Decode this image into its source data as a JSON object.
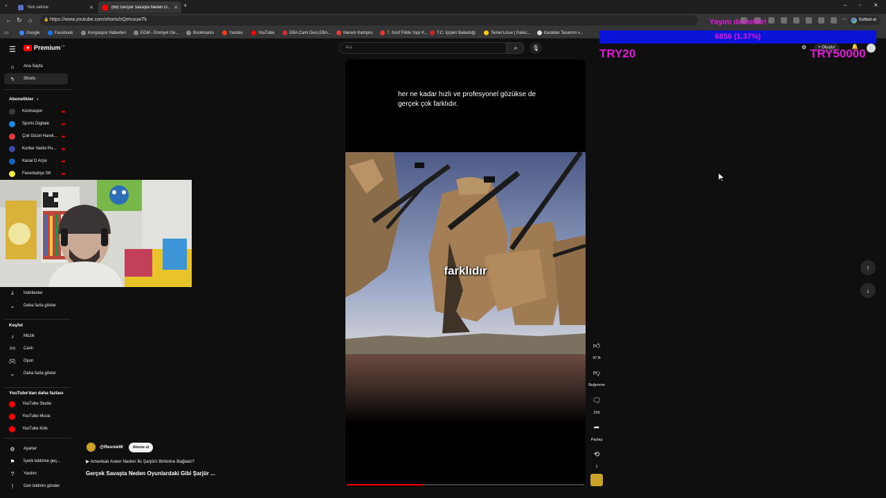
{
  "browser": {
    "tabs": [
      {
        "label": "Yeni sekme"
      },
      {
        "label": "(68) Gerçek Savaşta Neden O..."
      }
    ],
    "url": "https://www.youtube.com/shorts/nQetvuuwTk",
    "profile_label": "Sohbet et",
    "bookmarks": [
      {
        "label": "Google",
        "color": "#4285f4"
      },
      {
        "label": "Facebook",
        "color": "#1877f2"
      },
      {
        "label": "Konyaspor Haberleri",
        "color": "#888888"
      },
      {
        "label": "EGM - Emniyet Ge...",
        "color": "#888888"
      },
      {
        "label": "Bookmarks",
        "color": "#888888"
      },
      {
        "label": "Yandex",
        "color": "#fc3f1d"
      },
      {
        "label": "YouTube",
        "color": "#ff0000"
      },
      {
        "label": "EBA Canlı Ders,EBA...",
        "color": "#d32f2f"
      },
      {
        "label": "Meram Kampüs",
        "color": "#e53935"
      },
      {
        "label": "7. Sınıf Fiilde Yapı K...",
        "color": "#e53935"
      },
      {
        "label": "T.C. İçişleri Bakanlığı",
        "color": "#c62828"
      },
      {
        "label": "Temel Linux | Gelec...",
        "color": "#f9c80e"
      },
      {
        "label": "Karakter Tasarımı v...",
        "color": "#dddddd"
      }
    ]
  },
  "header": {
    "logo_text": "Premium",
    "logo_region": "TR",
    "search_placeholder": "Ara",
    "create_label": "+ Oluştur"
  },
  "sidebar": {
    "main": [
      {
        "label": "Ana Sayfa",
        "icon": "home-icon"
      },
      {
        "label": "Shorts",
        "icon": "shorts-icon"
      }
    ],
    "subscriptions_heading": "Abonelikler",
    "subscriptions": [
      {
        "label": "Kontraspor",
        "color": "#3a3a3a"
      },
      {
        "label": "Sports Digitale",
        "color": "#1e88e5"
      },
      {
        "label": "Çok Güzel Harek...",
        "color": "#e53935"
      },
      {
        "label": "Kurtlar Vadisi Pu...",
        "color": "#3949ab"
      },
      {
        "label": "Kanal D Arşiv",
        "color": "#1565c0"
      },
      {
        "label": "Fenerbahçe SK",
        "color": "#ffeb3b"
      }
    ],
    "you_items": [
      {
        "label": "İndirilenler",
        "icon": "download-icon"
      },
      {
        "label": "Daha fazla göster",
        "icon": "chevron-down-icon"
      }
    ],
    "explore_heading": "Keşfet",
    "explore": [
      {
        "label": "Müzik",
        "icon": "music-icon"
      },
      {
        "label": "Canlı",
        "icon": "live-icon"
      },
      {
        "label": "Oyun",
        "icon": "gaming-icon"
      },
      {
        "label": "Daha fazla göster",
        "icon": "chevron-down-icon"
      }
    ],
    "more_heading": "YouTube'dan daha fazlası",
    "more": [
      {
        "label": "YouTube Studio",
        "color": "#ff0000"
      },
      {
        "label": "YouTube Music",
        "color": "#ff0000"
      },
      {
        "label": "YouTube Kids",
        "color": "#ff0000"
      }
    ],
    "footer": [
      {
        "label": "Ayarlar",
        "icon": "gear-icon"
      },
      {
        "label": "İçerik bildirme geç...",
        "icon": "flag-icon"
      },
      {
        "label": "Yardım",
        "icon": "help-icon"
      },
      {
        "label": "Geri bildirim gönder",
        "icon": "feedback-icon"
      }
    ]
  },
  "video": {
    "top_subtitle": "her ne kadar hızlı ve profesyonel gözükse de gerçek çok farklıdır.",
    "caption": "farklıdır",
    "progress": 0.32,
    "channel_name": "@RexnieW",
    "subscribe_label": "Abone ol",
    "description": "Amerikalı Asker Neden İki Şarjörü Birbirine Bağladı?",
    "title": "Gerçek Savaşta Neden Oyunlardaki Gibi Şarjör ..."
  },
  "actions": {
    "like_count": "47 B",
    "dislike_label": "Beğenme",
    "comment_count": "259",
    "share_label": "Paylaş",
    "remix_count": "1"
  },
  "overlay": {
    "donation_goal": "Yayını destekle!",
    "donation_amount": "6856 (1.37%)",
    "goal_min": "TRY20",
    "goal_max": "TRY50000",
    "accent": "#e11ad8",
    "bar_color": "#0a14d6"
  }
}
